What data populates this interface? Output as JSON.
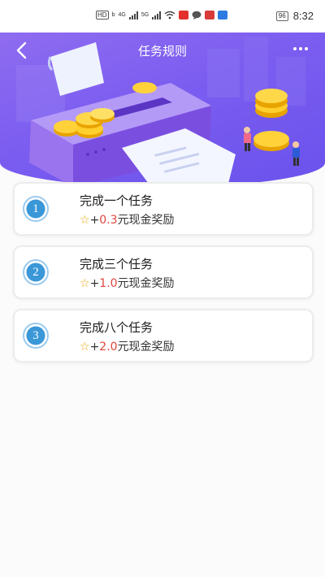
{
  "status_bar": {
    "network_badge": "HD",
    "network_sub": "b",
    "signal_1_label": "4G",
    "signal_2_label": "5G",
    "battery": "96",
    "time": "8:32"
  },
  "header": {
    "title": "任务规则"
  },
  "tasks": [
    {
      "number": "1",
      "title": "完成一个任务",
      "prefix": "+",
      "amount": "0.3",
      "suffix": "元现金奖励"
    },
    {
      "number": "2",
      "title": "完成三个任务",
      "prefix": "+",
      "amount": "1.0",
      "suffix": "元现金奖励"
    },
    {
      "number": "3",
      "title": "完成八个任务",
      "prefix": "+",
      "amount": "2.0",
      "suffix": "元现金奖励"
    }
  ],
  "colors": {
    "header_purple": "#7b5df0",
    "reward_amount": "#e0463c",
    "star": "#e8a400",
    "badge_blue": "#3a97d8"
  }
}
